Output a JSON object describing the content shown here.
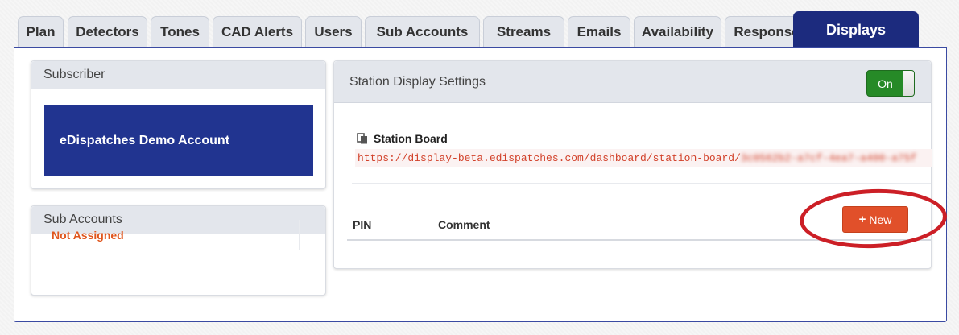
{
  "tabs": [
    {
      "label": "Plan"
    },
    {
      "label": "Detectors"
    },
    {
      "label": "Tones"
    },
    {
      "label": "CAD Alerts"
    },
    {
      "label": "Users"
    },
    {
      "label": "Sub Accounts"
    },
    {
      "label": "Streams"
    },
    {
      "label": "Emails"
    },
    {
      "label": "Availability"
    },
    {
      "label": "Response"
    },
    {
      "label": "Displays",
      "active": true
    }
  ],
  "subscriber": {
    "title": "Subscriber",
    "account_name": "eDispatches Demo Account"
  },
  "sub_accounts": {
    "title": "Sub Accounts",
    "items": [
      "Not Assigned"
    ]
  },
  "station_display": {
    "title": "Station Display Settings",
    "toggle_label": "On",
    "toggle_on": true,
    "board_title": "Station Board",
    "url_prefix": "https://display-beta.edispatches.com/dashboard/station-board/",
    "url_token": "3c0562b2-a7cf-4ea7-a400-a75f",
    "table_headers": {
      "pin": "PIN",
      "comment": "Comment"
    },
    "new_button_label": "New"
  },
  "colors": {
    "active_tab": "#1c2b7e",
    "subscriber_box": "#213490",
    "toggle_on": "#268a27",
    "new_button": "#e1502a",
    "url_text": "#d2412a",
    "highlight_ring": "#cc1f26"
  }
}
